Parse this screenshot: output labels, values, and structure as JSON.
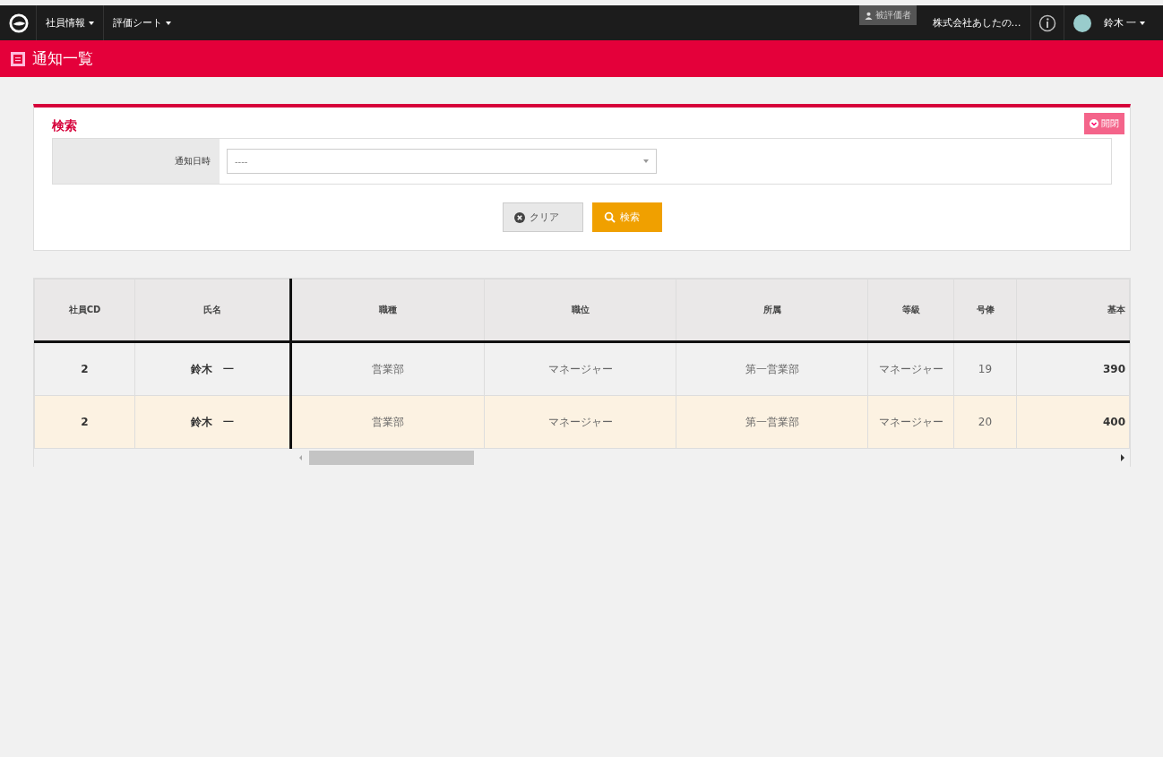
{
  "topbar": {
    "menus": [
      {
        "label": "社員情報"
      },
      {
        "label": "評価シート"
      }
    ],
    "role_badge": "被評価者",
    "company": "株式会社あしたの…",
    "user": "鈴木 一"
  },
  "page_title": "通知一覧",
  "search": {
    "title": "検索",
    "toggle_label": "開閉",
    "fields": [
      {
        "label": "通知日時",
        "placeholder": "----"
      }
    ],
    "clear_button": "クリア",
    "search_button": "検索"
  },
  "table": {
    "columns": [
      "社員CD",
      "氏名",
      "職種",
      "職位",
      "所属",
      "等級",
      "号俸",
      "基本"
    ],
    "rows": [
      {
        "selected": false,
        "cells": [
          "2",
          "鈴木　一",
          "営業部",
          "マネージャー",
          "第一営業部",
          "マネージャー",
          "19",
          "390"
        ]
      },
      {
        "selected": true,
        "cells": [
          "2",
          "鈴木　一",
          "営業部",
          "マネージャー",
          "第一営業部",
          "マネージャー",
          "20",
          "400"
        ]
      }
    ]
  }
}
